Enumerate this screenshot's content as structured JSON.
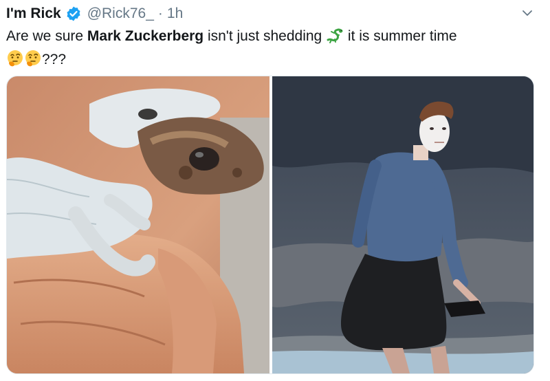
{
  "tweet": {
    "display_name": "I'm Rick",
    "handle": "@Rick76_",
    "separator": "·",
    "time": "1h",
    "text_before": "Are we sure ",
    "text_bold": "Mark Zuckerberg",
    "text_middle": " isn't just shedding ",
    "text_after": " it is summer time",
    "text_end": "???",
    "icons": {
      "verified": "verified-badge-icon",
      "menu": "chevron-down-icon",
      "lizard": "lizard-emoji",
      "thinking": "thinking-face-emoji"
    },
    "colors": {
      "verified": "#1da1f2",
      "muted": "#657786",
      "text": "#14171a"
    }
  }
}
